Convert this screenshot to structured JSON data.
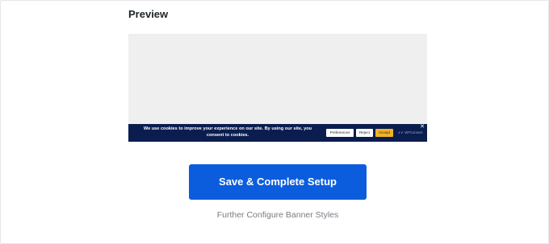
{
  "preview": {
    "title": "Preview"
  },
  "banner": {
    "message": "We use cookies to improve your experience on our site. By using our site, you consent to cookies.",
    "preferences_label": "Preferences",
    "reject_label": "Reject",
    "accept_label": "Accept",
    "brand_label": "WPConsent",
    "close_symbol": "✕",
    "background_color": "#0b1d4f",
    "accept_color": "#f0b429"
  },
  "actions": {
    "save_label": "Save & Complete Setup",
    "configure_label": "Further Configure Banner Styles",
    "accent_color": "#0b5dde"
  }
}
